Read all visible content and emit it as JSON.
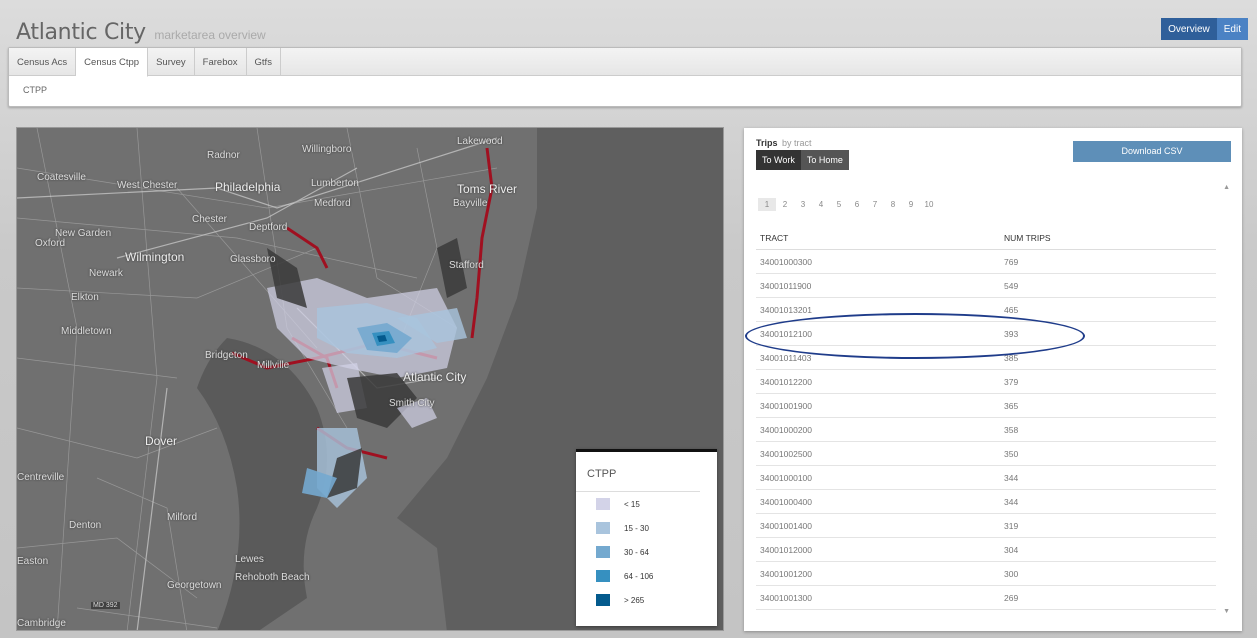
{
  "header": {
    "title": "Atlantic City",
    "subtitle": "marketarea overview",
    "buttons": {
      "overview": "Overview",
      "edit": "Edit"
    }
  },
  "tabs": {
    "items": [
      "Census Acs",
      "Census Ctpp",
      "Survey",
      "Farebox",
      "Gtfs"
    ],
    "active": "Census Ctpp",
    "content_label": "CTPP"
  },
  "map": {
    "labels": [
      "Lakewood",
      "Radnor",
      "Willingboro",
      "Coatesville",
      "West Chester",
      "Philadelphia",
      "Lumberton",
      "Toms River",
      "Medford",
      "Bayville",
      "Chester",
      "Deptford",
      "New Garden",
      "Oxford",
      "Wilmington",
      "Newark",
      "Glassboro",
      "Stafford",
      "Elkton",
      "Middletown",
      "Bridgeton",
      "Millville",
      "Atlantic City",
      "Smith City",
      "Dover",
      "Milford",
      "Denton",
      "Lewes",
      "Rehoboth Beach",
      "Georgetown",
      "MD 392",
      "Centreville",
      "Easton",
      "Cambridge"
    ],
    "legend": {
      "title": "CTPP",
      "items": [
        {
          "label": "< 15",
          "color": "#d3d3e8"
        },
        {
          "label": "15 - 30",
          "color": "#a9c4dd"
        },
        {
          "label": "30 - 64",
          "color": "#74a9cf"
        },
        {
          "label": "64 - 106",
          "color": "#3690c0"
        },
        {
          "label": "> 265",
          "color": "#045a8d"
        }
      ]
    }
  },
  "panel": {
    "title": "Trips",
    "subtitle": "by tract",
    "toggle": {
      "work": "To Work",
      "home": "To Home"
    },
    "download_label": "Download CSV",
    "pages": [
      "1",
      "2",
      "3",
      "4",
      "5",
      "6",
      "7",
      "8",
      "9",
      "10"
    ],
    "headers": {
      "tract": "TRACT",
      "trips": "NUM TRIPS"
    },
    "rows": [
      {
        "tract": "34001000300",
        "trips": "769"
      },
      {
        "tract": "34001011900",
        "trips": "549"
      },
      {
        "tract": "34001013201",
        "trips": "465"
      },
      {
        "tract": "34001012100",
        "trips": "393"
      },
      {
        "tract": "34001011403",
        "trips": "385"
      },
      {
        "tract": "34001012200",
        "trips": "379"
      },
      {
        "tract": "34001001900",
        "trips": "365"
      },
      {
        "tract": "34001000200",
        "trips": "358"
      },
      {
        "tract": "34001002500",
        "trips": "350"
      },
      {
        "tract": "34001000100",
        "trips": "344"
      },
      {
        "tract": "34001000400",
        "trips": "344"
      },
      {
        "tract": "34001001400",
        "trips": "319"
      },
      {
        "tract": "34001012000",
        "trips": "304"
      },
      {
        "tract": "34001001200",
        "trips": "300"
      },
      {
        "tract": "34001001300",
        "trips": "269"
      }
    ]
  }
}
